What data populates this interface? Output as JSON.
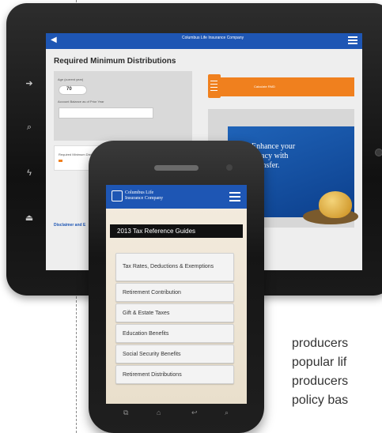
{
  "tablet": {
    "header": {
      "logo_text": "Columbus Life Insurance Company"
    },
    "title": "Required Minimum Distributions",
    "age_label": "Age (current year)",
    "age_value": "70",
    "balance_label": "Account Balance as of Prior Year",
    "rmd_label": "Required Minimum Distribution",
    "action_button": "Calculate RMD",
    "ad_text": "Enhance your legacy with Transfer.",
    "disclaimer_link": "Disclaimer and E"
  },
  "phone": {
    "header": {
      "logo_text": "Columbus Life Insurance Company"
    },
    "subtitle": "2013 Tax Reference Guides",
    "items": [
      "Tax Rates, Deductions & Exemptions",
      "Retirement Contribution",
      "Gift & Estate Taxes",
      "Education Benefits",
      "Social Security Benefits",
      "Retirement Distributions"
    ]
  },
  "body_text": {
    "line1": "producers",
    "line2": "popular lif",
    "line3": "producers",
    "line4": "policy bas"
  }
}
